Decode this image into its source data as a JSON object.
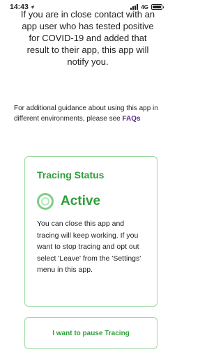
{
  "status_bar": {
    "time": "14:43",
    "location_icon": "location-arrow-icon",
    "network": "4G"
  },
  "intro_text": "If you are in close contact with an app user who has tested positive for COVID-19 and added that result to their app, this app will notify you.",
  "guidance": {
    "text": "For additional guidance about using this app in different environments, please see",
    "link_label": "FAQs"
  },
  "tracing_card": {
    "title": "Tracing Status",
    "status": "Active",
    "status_icon": "radar-ring-icon",
    "body": "You can close this app and tracing will keep working. If you want to stop tracing and opt out select 'Leave' from the 'Settings' menu in this app."
  },
  "pause_button_label": "I want to pause Tracing",
  "colors": {
    "accent": "#2e9e3a",
    "border": "#9bd99e",
    "link": "#5b2a86",
    "text": "#1f1f1f"
  }
}
